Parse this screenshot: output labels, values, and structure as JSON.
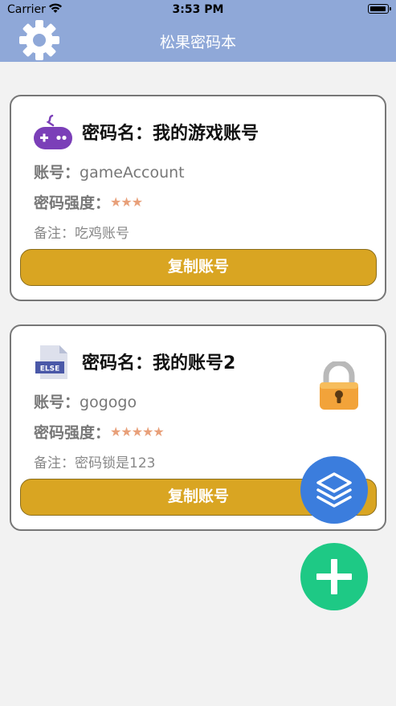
{
  "status_bar": {
    "carrier": "Carrier",
    "time": "3:53 PM",
    "wifi_icon": "wifi-icon",
    "battery_icon": "battery-icon"
  },
  "nav": {
    "title": "松果密码本",
    "settings_icon": "gear-icon"
  },
  "cards": [
    {
      "icon": "gamepad-icon",
      "name": "密码名：我的游戏账号",
      "account_label": "账号：",
      "account": "gameAccount",
      "strength_label": "密码强度：",
      "strength": 3,
      "stars": "★★★",
      "note": "备注：吃鸡账号",
      "copy_label": "复制账号"
    },
    {
      "icon": "else-file-icon",
      "icon_text": "ELSE",
      "name": "密码名：我的账号2",
      "account_label": "账号：",
      "account": "gogogo",
      "strength_label": "密码强度：",
      "strength": 5,
      "stars": "★★★★★",
      "note": "备注：密码锁是123",
      "copy_label": "复制账号",
      "locked": true
    }
  ],
  "fabs": {
    "layers_icon": "layers-icon",
    "add_icon": "plus-icon"
  },
  "colors": {
    "nav_bg": "#8fa8d8",
    "copy_button": "#d9a522",
    "star": "#e8a07a",
    "fab_layers": "#3b7ddd",
    "fab_add": "#1ec985"
  }
}
